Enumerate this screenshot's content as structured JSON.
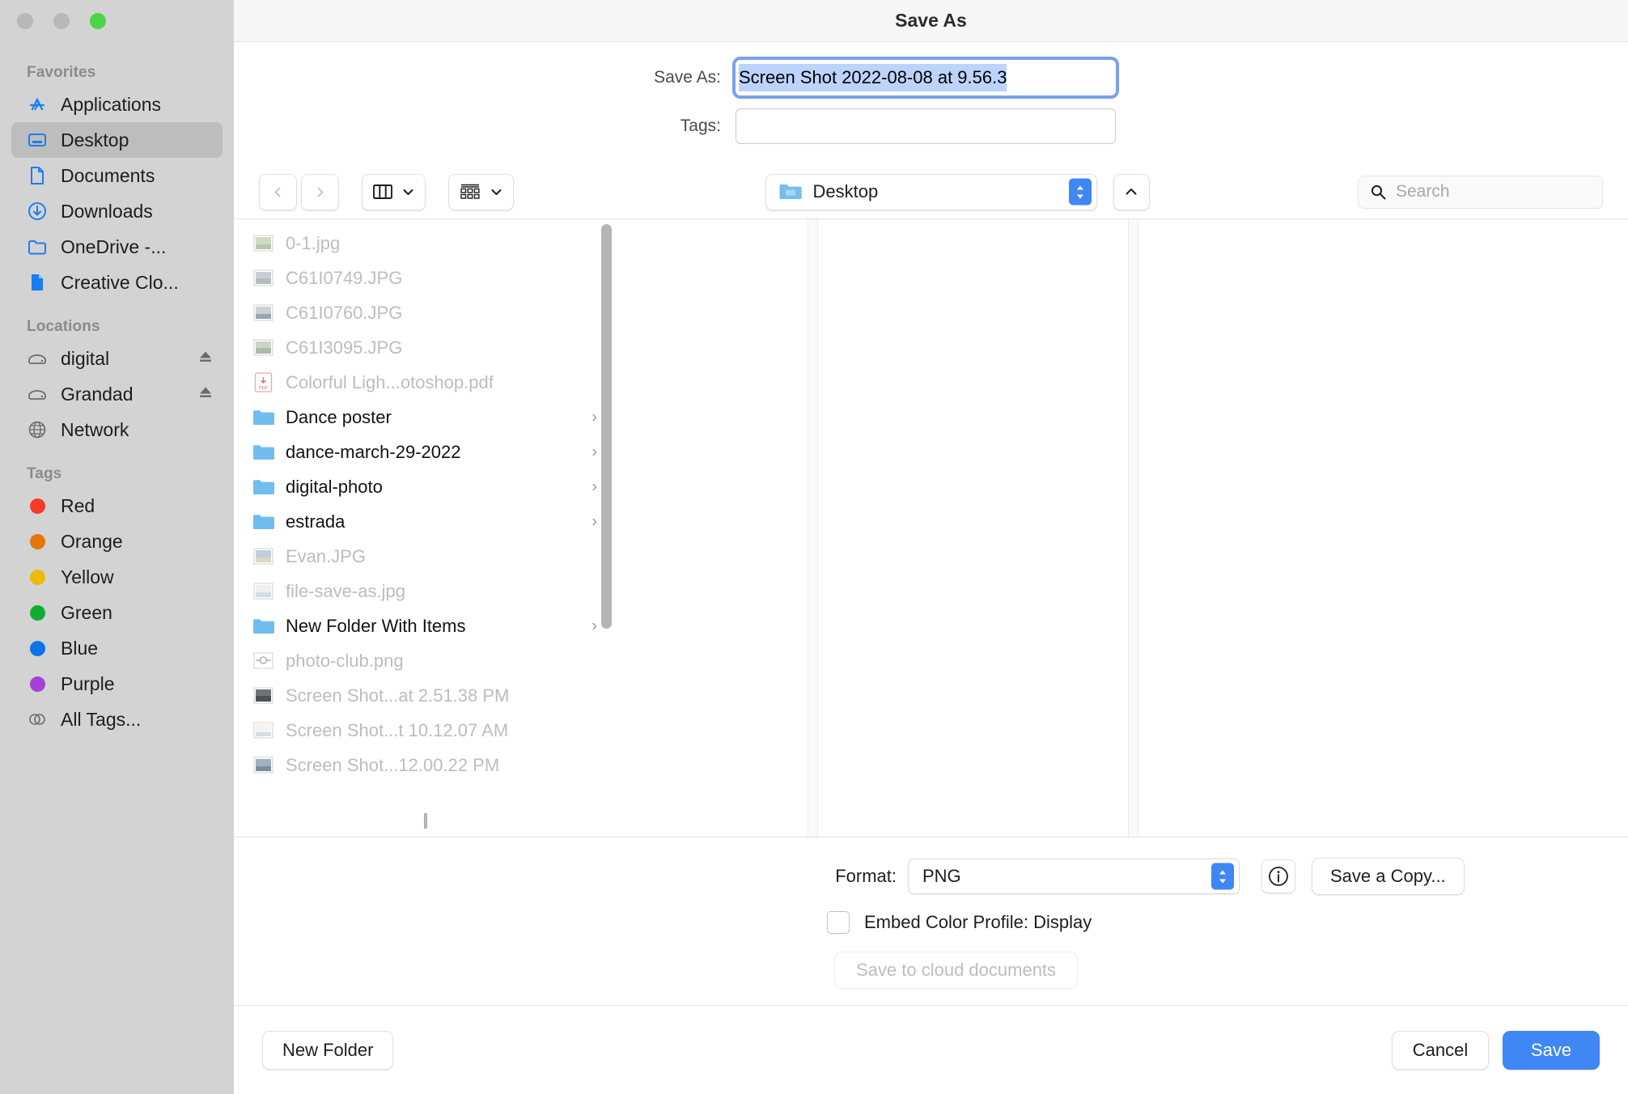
{
  "window": {
    "title": "Save As",
    "traffic_lights": [
      "close",
      "minimize",
      "zoom"
    ]
  },
  "fields": {
    "save_as_label": "Save As:",
    "save_as_value": "Screen Shot 2022-08-08 at 9.56.3",
    "tags_label": "Tags:",
    "tags_value": ""
  },
  "toolbar": {
    "back_icon": "chevron-left-icon",
    "forward_icon": "chevron-right-icon",
    "view_icon": "column-view-icon",
    "group_icon": "group-items-icon",
    "path_label": "Desktop",
    "up_icon": "chevron-up-icon",
    "search_placeholder": "Search"
  },
  "sidebar": {
    "sections": [
      {
        "title": "Favorites",
        "items": [
          {
            "label": "Applications",
            "icon": "applications-icon",
            "selected": false
          },
          {
            "label": "Desktop",
            "icon": "desktop-icon",
            "selected": true
          },
          {
            "label": "Documents",
            "icon": "document-icon",
            "selected": false
          },
          {
            "label": "Downloads",
            "icon": "downloads-icon",
            "selected": false
          },
          {
            "label": "OneDrive -...",
            "icon": "folder-icon",
            "selected": false
          },
          {
            "label": "Creative Clo...",
            "icon": "creative-cloud-icon",
            "selected": false
          }
        ]
      },
      {
        "title": "Locations",
        "items": [
          {
            "label": "digital",
            "icon": "external-drive-icon",
            "eject": true
          },
          {
            "label": "Grandad",
            "icon": "external-drive-icon",
            "eject": true
          },
          {
            "label": "Network",
            "icon": "globe-icon",
            "eject": false
          }
        ]
      },
      {
        "title": "Tags",
        "items": [
          {
            "label": "Red",
            "icon": "tag-dot-icon",
            "color": "#f73a2a"
          },
          {
            "label": "Orange",
            "icon": "tag-dot-icon",
            "color": "#e8760a"
          },
          {
            "label": "Yellow",
            "icon": "tag-dot-icon",
            "color": "#eeba0b"
          },
          {
            "label": "Green",
            "icon": "tag-dot-icon",
            "color": "#11ad32"
          },
          {
            "label": "Blue",
            "icon": "tag-dot-icon",
            "color": "#0a74e8"
          },
          {
            "label": "Purple",
            "icon": "tag-dot-icon",
            "color": "#a540d6"
          },
          {
            "label": "All Tags...",
            "icon": "all-tags-icon",
            "color": ""
          }
        ]
      }
    ]
  },
  "file_list": [
    {
      "name": "0-1.jpg",
      "type": "image",
      "enabled": false
    },
    {
      "name": "C61I0749.JPG",
      "type": "image",
      "enabled": false
    },
    {
      "name": "C61I0760.JPG",
      "type": "image",
      "enabled": false
    },
    {
      "name": "C61I3095.JPG",
      "type": "image",
      "enabled": false
    },
    {
      "name": "Colorful Ligh...otoshop.pdf",
      "type": "pdf",
      "enabled": false
    },
    {
      "name": "Dance poster",
      "type": "folder",
      "enabled": true
    },
    {
      "name": "dance-march-29-2022",
      "type": "folder",
      "enabled": true
    },
    {
      "name": "digital-photo",
      "type": "folder",
      "enabled": true
    },
    {
      "name": "estrada",
      "type": "folder",
      "enabled": true
    },
    {
      "name": "Evan.JPG",
      "type": "image",
      "enabled": false
    },
    {
      "name": "file-save-as.jpg",
      "type": "image",
      "enabled": false
    },
    {
      "name": "New Folder With Items",
      "type": "folder",
      "enabled": true
    },
    {
      "name": "photo-club.png",
      "type": "image",
      "enabled": false
    },
    {
      "name": "Screen Shot...at 2.51.38 PM",
      "type": "image",
      "enabled": false
    },
    {
      "name": "Screen Shot...t 10.12.07 AM",
      "type": "image",
      "enabled": false
    },
    {
      "name": "Screen Shot...12.00.22 PM",
      "type": "image",
      "enabled": false
    }
  ],
  "options": {
    "format_label": "Format:",
    "format_value": "PNG",
    "info_icon": "info-icon",
    "save_copy_label": "Save a Copy...",
    "embed_label": "Embed Color Profile:  Display",
    "embed_checked": false,
    "cloud_label": "Save to cloud documents",
    "cloud_enabled": false
  },
  "footer": {
    "new_folder_label": "New Folder",
    "cancel_label": "Cancel",
    "save_label": "Save"
  },
  "colors": {
    "accent": "#3f87f5",
    "sidebar_bg": "#d3d3d3",
    "selection": "#bcd4fb"
  }
}
